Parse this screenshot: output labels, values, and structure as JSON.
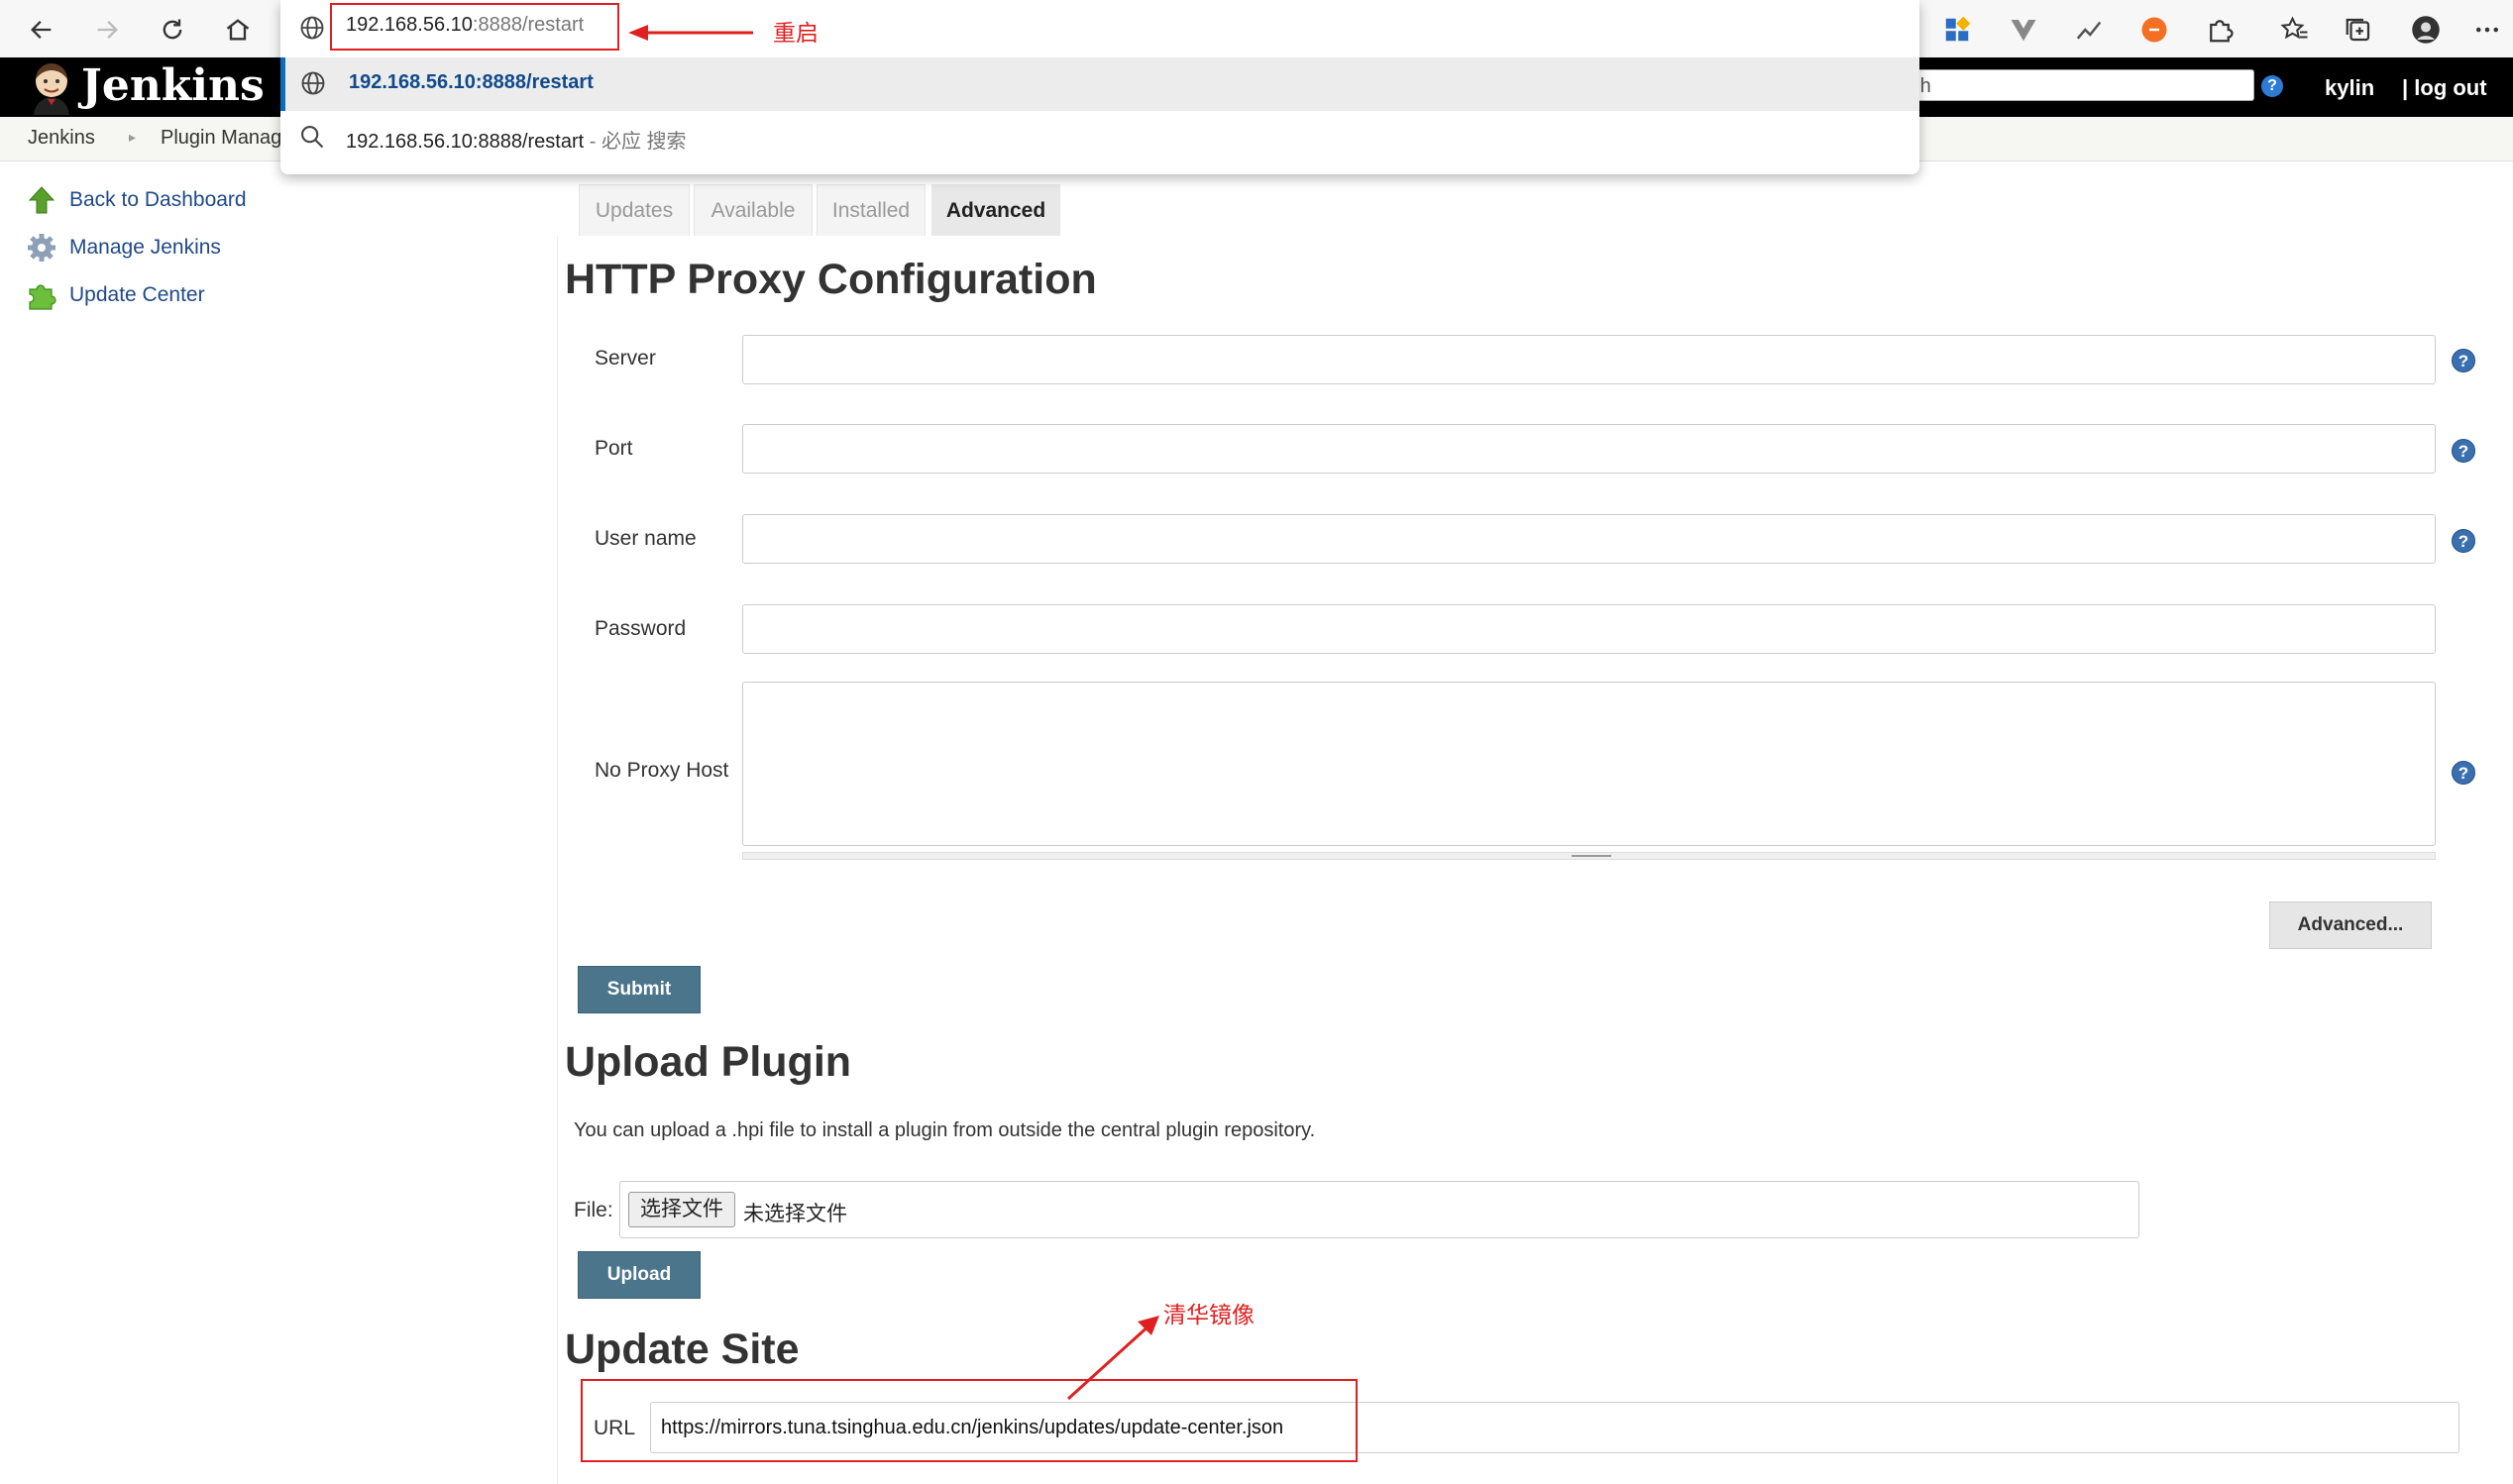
{
  "browser": {
    "address_text": "192.168.56.10",
    "address_dim": ":8888/restart",
    "suggestion_1": "192.168.56.10:8888/restart",
    "suggestion_2": "192.168.56.10:8888/restart",
    "suggestion_2_suffix": " - 必应 搜索"
  },
  "annotations": {
    "restart_note": "重启",
    "mirror_note": "清华镜像"
  },
  "header": {
    "logo_text": "Jenkins",
    "search_placeholder": "rch",
    "user": "kylin",
    "logout": "| log out"
  },
  "breadcrumb": {
    "items": [
      "Jenkins",
      "Plugin Manag"
    ]
  },
  "sidebar": {
    "items": [
      {
        "label": "Back to Dashboard",
        "icon": "up-arrow-icon"
      },
      {
        "label": "Manage Jenkins",
        "icon": "gear-icon"
      },
      {
        "label": "Update Center",
        "icon": "puzzle-icon"
      }
    ]
  },
  "tabs": [
    {
      "label": "Updates",
      "active": false
    },
    {
      "label": "Available",
      "active": false
    },
    {
      "label": "Installed",
      "active": false
    },
    {
      "label": "Advanced",
      "active": true
    }
  ],
  "proxy": {
    "title": "HTTP Proxy Configuration",
    "fields": [
      {
        "label": "Server",
        "value": ""
      },
      {
        "label": "Port",
        "value": ""
      },
      {
        "label": "User name",
        "value": ""
      },
      {
        "label": "Password",
        "value": ""
      },
      {
        "label": "No Proxy Host",
        "value": ""
      }
    ],
    "advanced_button": "Advanced...",
    "submit_button": "Submit"
  },
  "upload": {
    "title": "Upload Plugin",
    "description": "You can upload a .hpi file to install a plugin from outside the central plugin repository.",
    "file_label": "File:",
    "choose_button": "选择文件",
    "no_file_text": "未选择文件",
    "upload_button": "Upload"
  },
  "update_site": {
    "title": "Update Site",
    "url_label": "URL",
    "url_value": "https://mirrors.tuna.tsinghua.edu.cn/jenkins/updates/update-center.json"
  },
  "colors": {
    "accent_blue": "#4b758b",
    "annotation_red": "#e02020",
    "header_black": "#000000"
  }
}
